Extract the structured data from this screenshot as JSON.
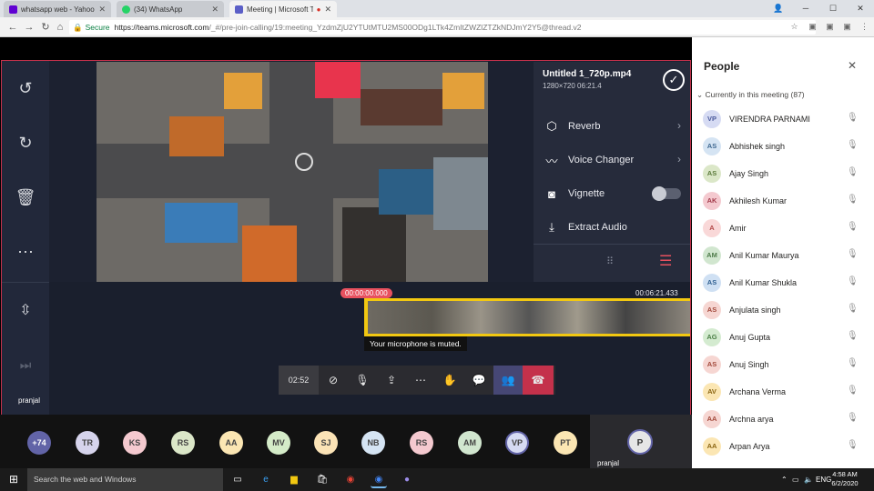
{
  "browser": {
    "tabs": [
      {
        "title": "whatsapp web - Yahoo Se",
        "icon": "yahoo-icon",
        "color": "#6001d2"
      },
      {
        "title": "(34) WhatsApp",
        "icon": "whatsapp-icon",
        "color": "#25d366"
      },
      {
        "title": "Meeting | Microsoft T",
        "icon": "teams-icon",
        "color": "#5b5fc7"
      }
    ],
    "secure_label": "Secure",
    "url_host": "https://teams.microsoft.com",
    "url_path": "/_#/pre-join-calling/19:meeting_YzdmZjU2YTUtMTU2MS00ODg1LTk4ZmItZWZlZTZkNDJmY2Y5@thread.v2"
  },
  "editor": {
    "file_name": "Untitled 1_720p.mp4",
    "file_info": "1280×720  06:21.4",
    "effects": [
      {
        "label": "Reverb",
        "icon": "cube-icon"
      },
      {
        "label": "Voice Changer",
        "icon": "waveform-icon"
      },
      {
        "label": "Vignette",
        "icon": "vignette-icon"
      },
      {
        "label": "Extract Audio",
        "icon": "extract-audio-icon"
      }
    ],
    "timecode_start": "00:00:00.000",
    "timecode_end": "00:06:21.433"
  },
  "call": {
    "mic_tooltip": "Your microphone is muted.",
    "duration": "02:52",
    "presenter_name": "pranjal"
  },
  "strip": {
    "overflow_count": "+74",
    "avatars": [
      {
        "initials": "TR",
        "color": "#d6d4ec"
      },
      {
        "initials": "KS",
        "color": "#f4c9cf"
      },
      {
        "initials": "RS",
        "color": "#dbe7c8"
      },
      {
        "initials": "AA",
        "color": "#fbe6b3"
      },
      {
        "initials": "MV",
        "color": "#d4ebc8"
      },
      {
        "initials": "SJ",
        "color": "#fbe3b6"
      },
      {
        "initials": "NB",
        "color": "#d5e4f3"
      },
      {
        "initials": "RS",
        "color": "#f4c9cf"
      },
      {
        "initials": "AM",
        "color": "#d1e6cf"
      },
      {
        "initials": "VP",
        "color": "#d6dbf3"
      },
      {
        "initials": "PT",
        "color": "#fbe6b3"
      }
    ],
    "self_initial": "P",
    "self_name": "pranjal"
  },
  "panel": {
    "title": "People",
    "section": "Currently in this meeting (87)",
    "people": [
      {
        "initials": "VP",
        "name": "VIRENDRA PARNAMI",
        "color": "#d6dbf3",
        "fg": "#4a5a9c"
      },
      {
        "initials": "AS",
        "name": "Abhishek singh",
        "color": "#d5e4f3",
        "fg": "#3f6890"
      },
      {
        "initials": "AS",
        "name": "Ajay Singh",
        "color": "#dbe7c8",
        "fg": "#5b7a3a"
      },
      {
        "initials": "AK",
        "name": "Akhilesh Kumar",
        "color": "#f4c9cf",
        "fg": "#a23a4a"
      },
      {
        "initials": "A",
        "name": "Amir",
        "color": "#f9d8d8",
        "fg": "#b24848"
      },
      {
        "initials": "AM",
        "name": "Anil Kumar Maurya",
        "color": "#d1e6cf",
        "fg": "#4d7a48"
      },
      {
        "initials": "AS",
        "name": "Anil Kumar Shukla",
        "color": "#cfe0f3",
        "fg": "#2f5f90"
      },
      {
        "initials": "AS",
        "name": "Anjulata singh",
        "color": "#f6d6d2",
        "fg": "#a2483a"
      },
      {
        "initials": "AG",
        "name": "Anuj Gupta",
        "color": "#d4ebd0",
        "fg": "#4a7f45"
      },
      {
        "initials": "AS",
        "name": "Anuj Singh",
        "color": "#f6d6d2",
        "fg": "#a2483a"
      },
      {
        "initials": "AV",
        "name": "Archana Verma",
        "color": "#fbe6b3",
        "fg": "#8a6512"
      },
      {
        "initials": "AA",
        "name": "Archna arya",
        "color": "#f6d6d2",
        "fg": "#a2483a"
      },
      {
        "initials": "AA",
        "name": "Arpan Arya",
        "color": "#fbe6b3",
        "fg": "#8a6512"
      }
    ]
  },
  "taskbar": {
    "search_placeholder": "Search the web and Windows",
    "lang": "ENG",
    "time": "4:58 AM",
    "date": "6/2/2020"
  }
}
